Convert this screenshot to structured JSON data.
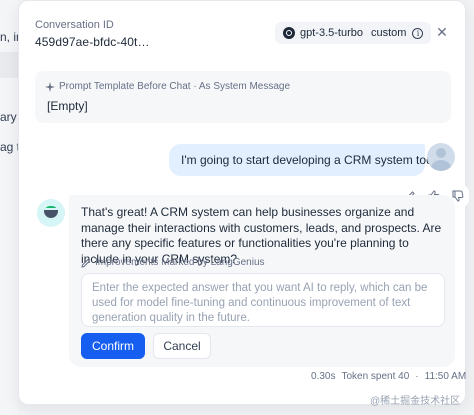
{
  "background": {
    "fragments": [
      "n, in",
      "ary",
      "ag to"
    ]
  },
  "header": {
    "conversation_label": "Conversation ID",
    "conversation_id": "459d97ae-bfdc-40t…",
    "model": "gpt-3.5-turbo",
    "mode": "custom"
  },
  "system_prompt": {
    "title": "Prompt Template Before Chat · As System Message",
    "value": "[Empty]"
  },
  "user_message": {
    "text": "I'm going to start developing a CRM system today."
  },
  "assistant_message": {
    "text": "That's great! A CRM system can help businesses organize and manage their interactions with customers, leads, and prospects. Are there any specific features or functionalities you're planning to include in your CRM system?",
    "improvement_label": "Improvements Marked by LangGenius",
    "improvement_placeholder": "Enter the expected answer that you want AI to reply, which can be used for model fine-tuning and continuous improvement of text generation quality in the future.",
    "confirm_label": "Confirm",
    "cancel_label": "Cancel"
  },
  "meta": {
    "latency": "0.30s",
    "tokens": "Token spent 40",
    "separator": "·",
    "time": "11:50 AM"
  },
  "watermark": "@稀土掘金技术社区",
  "colors": {
    "primary": "#155eef",
    "user_bubble": "#e1effe",
    "card_bg": "#f6f7f9"
  }
}
